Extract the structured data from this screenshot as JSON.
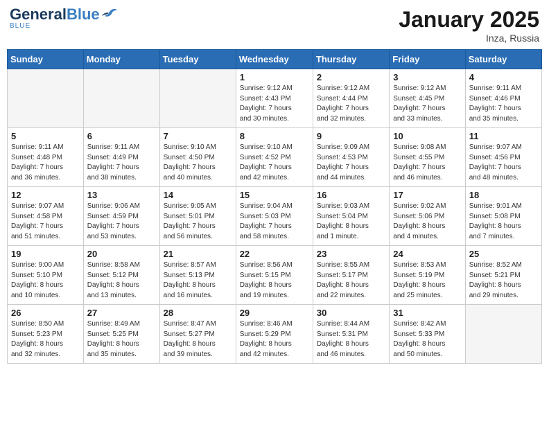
{
  "header": {
    "logo_general": "General",
    "logo_blue": "Blue",
    "month_title": "January 2025",
    "location": "Inza, Russia"
  },
  "days_of_week": [
    "Sunday",
    "Monday",
    "Tuesday",
    "Wednesday",
    "Thursday",
    "Friday",
    "Saturday"
  ],
  "weeks": [
    [
      {
        "day": "",
        "info": ""
      },
      {
        "day": "",
        "info": ""
      },
      {
        "day": "",
        "info": ""
      },
      {
        "day": "1",
        "info": "Sunrise: 9:12 AM\nSunset: 4:43 PM\nDaylight: 7 hours\nand 30 minutes."
      },
      {
        "day": "2",
        "info": "Sunrise: 9:12 AM\nSunset: 4:44 PM\nDaylight: 7 hours\nand 32 minutes."
      },
      {
        "day": "3",
        "info": "Sunrise: 9:12 AM\nSunset: 4:45 PM\nDaylight: 7 hours\nand 33 minutes."
      },
      {
        "day": "4",
        "info": "Sunrise: 9:11 AM\nSunset: 4:46 PM\nDaylight: 7 hours\nand 35 minutes."
      }
    ],
    [
      {
        "day": "5",
        "info": "Sunrise: 9:11 AM\nSunset: 4:48 PM\nDaylight: 7 hours\nand 36 minutes."
      },
      {
        "day": "6",
        "info": "Sunrise: 9:11 AM\nSunset: 4:49 PM\nDaylight: 7 hours\nand 38 minutes."
      },
      {
        "day": "7",
        "info": "Sunrise: 9:10 AM\nSunset: 4:50 PM\nDaylight: 7 hours\nand 40 minutes."
      },
      {
        "day": "8",
        "info": "Sunrise: 9:10 AM\nSunset: 4:52 PM\nDaylight: 7 hours\nand 42 minutes."
      },
      {
        "day": "9",
        "info": "Sunrise: 9:09 AM\nSunset: 4:53 PM\nDaylight: 7 hours\nand 44 minutes."
      },
      {
        "day": "10",
        "info": "Sunrise: 9:08 AM\nSunset: 4:55 PM\nDaylight: 7 hours\nand 46 minutes."
      },
      {
        "day": "11",
        "info": "Sunrise: 9:07 AM\nSunset: 4:56 PM\nDaylight: 7 hours\nand 48 minutes."
      }
    ],
    [
      {
        "day": "12",
        "info": "Sunrise: 9:07 AM\nSunset: 4:58 PM\nDaylight: 7 hours\nand 51 minutes."
      },
      {
        "day": "13",
        "info": "Sunrise: 9:06 AM\nSunset: 4:59 PM\nDaylight: 7 hours\nand 53 minutes."
      },
      {
        "day": "14",
        "info": "Sunrise: 9:05 AM\nSunset: 5:01 PM\nDaylight: 7 hours\nand 56 minutes."
      },
      {
        "day": "15",
        "info": "Sunrise: 9:04 AM\nSunset: 5:03 PM\nDaylight: 7 hours\nand 58 minutes."
      },
      {
        "day": "16",
        "info": "Sunrise: 9:03 AM\nSunset: 5:04 PM\nDaylight: 8 hours\nand 1 minute."
      },
      {
        "day": "17",
        "info": "Sunrise: 9:02 AM\nSunset: 5:06 PM\nDaylight: 8 hours\nand 4 minutes."
      },
      {
        "day": "18",
        "info": "Sunrise: 9:01 AM\nSunset: 5:08 PM\nDaylight: 8 hours\nand 7 minutes."
      }
    ],
    [
      {
        "day": "19",
        "info": "Sunrise: 9:00 AM\nSunset: 5:10 PM\nDaylight: 8 hours\nand 10 minutes."
      },
      {
        "day": "20",
        "info": "Sunrise: 8:58 AM\nSunset: 5:12 PM\nDaylight: 8 hours\nand 13 minutes."
      },
      {
        "day": "21",
        "info": "Sunrise: 8:57 AM\nSunset: 5:13 PM\nDaylight: 8 hours\nand 16 minutes."
      },
      {
        "day": "22",
        "info": "Sunrise: 8:56 AM\nSunset: 5:15 PM\nDaylight: 8 hours\nand 19 minutes."
      },
      {
        "day": "23",
        "info": "Sunrise: 8:55 AM\nSunset: 5:17 PM\nDaylight: 8 hours\nand 22 minutes."
      },
      {
        "day": "24",
        "info": "Sunrise: 8:53 AM\nSunset: 5:19 PM\nDaylight: 8 hours\nand 25 minutes."
      },
      {
        "day": "25",
        "info": "Sunrise: 8:52 AM\nSunset: 5:21 PM\nDaylight: 8 hours\nand 29 minutes."
      }
    ],
    [
      {
        "day": "26",
        "info": "Sunrise: 8:50 AM\nSunset: 5:23 PM\nDaylight: 8 hours\nand 32 minutes."
      },
      {
        "day": "27",
        "info": "Sunrise: 8:49 AM\nSunset: 5:25 PM\nDaylight: 8 hours\nand 35 minutes."
      },
      {
        "day": "28",
        "info": "Sunrise: 8:47 AM\nSunset: 5:27 PM\nDaylight: 8 hours\nand 39 minutes."
      },
      {
        "day": "29",
        "info": "Sunrise: 8:46 AM\nSunset: 5:29 PM\nDaylight: 8 hours\nand 42 minutes."
      },
      {
        "day": "30",
        "info": "Sunrise: 8:44 AM\nSunset: 5:31 PM\nDaylight: 8 hours\nand 46 minutes."
      },
      {
        "day": "31",
        "info": "Sunrise: 8:42 AM\nSunset: 5:33 PM\nDaylight: 8 hours\nand 50 minutes."
      },
      {
        "day": "",
        "info": ""
      }
    ]
  ]
}
